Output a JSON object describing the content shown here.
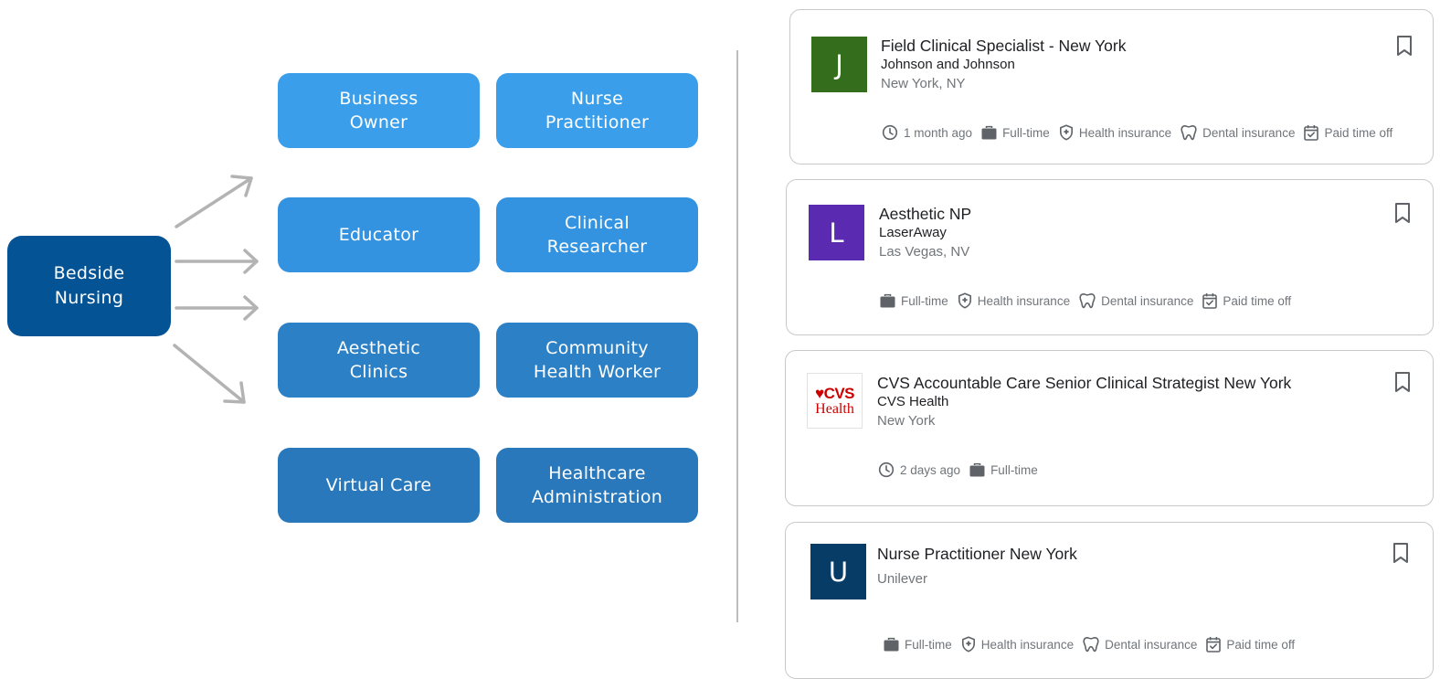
{
  "diagram": {
    "source": "Bedside\nNursing",
    "careers": [
      "Business\nOwner",
      "Nurse\nPractitioner",
      "Educator",
      "Clinical\nResearcher",
      "Aesthetic\nClinics",
      "Community\nHealth Worker",
      "Virtual Care",
      "Healthcare\nAdministration"
    ]
  },
  "colors": {
    "source_bg": "#045395",
    "row1": "#3a9eea",
    "row2": "#3493e0",
    "row3": "#2c80c6",
    "row4": "#2878bb",
    "arrow": "#b3b3b3",
    "logo_j": "#346d1b",
    "logo_l": "#5a2bb0",
    "logo_u": "#063c66"
  },
  "jobs": [
    {
      "title": "Field Clinical Specialist - New York",
      "company": "Johnson and Johnson",
      "location": "New York, NY",
      "logo_letter": "J",
      "tags": [
        {
          "icon": "clock-icon",
          "text": "1 month ago"
        },
        {
          "icon": "briefcase-icon",
          "text": "Full-time"
        },
        {
          "icon": "health-shield-icon",
          "text": "Health insurance"
        },
        {
          "icon": "tooth-icon",
          "text": "Dental insurance"
        },
        {
          "icon": "calendar-check-icon",
          "text": "Paid time off"
        }
      ]
    },
    {
      "title": "Aesthetic NP",
      "company": "LaserAway",
      "location": "Las Vegas, NV",
      "logo_letter": "L",
      "tags": [
        {
          "icon": "briefcase-icon",
          "text": "Full-time"
        },
        {
          "icon": "health-shield-icon",
          "text": "Health insurance"
        },
        {
          "icon": "tooth-icon",
          "text": "Dental insurance"
        },
        {
          "icon": "calendar-check-icon",
          "text": "Paid time off"
        }
      ]
    },
    {
      "title": "CVS Accountable Care Senior Clinical Strategist New York",
      "company": "CVS Health",
      "location": "New York",
      "logo_top": "♥CVS",
      "logo_bottom": "Health",
      "tags": [
        {
          "icon": "clock-icon",
          "text": "2 days ago"
        },
        {
          "icon": "briefcase-icon",
          "text": "Full-time"
        }
      ]
    },
    {
      "title": "Nurse Practitioner New York",
      "location": "Unilever",
      "logo_letter": "U",
      "tags": [
        {
          "icon": "briefcase-icon",
          "text": "Full-time"
        },
        {
          "icon": "health-shield-icon",
          "text": "Health insurance"
        },
        {
          "icon": "tooth-icon",
          "text": "Dental insurance"
        },
        {
          "icon": "calendar-check-icon",
          "text": "Paid time off"
        }
      ]
    }
  ]
}
